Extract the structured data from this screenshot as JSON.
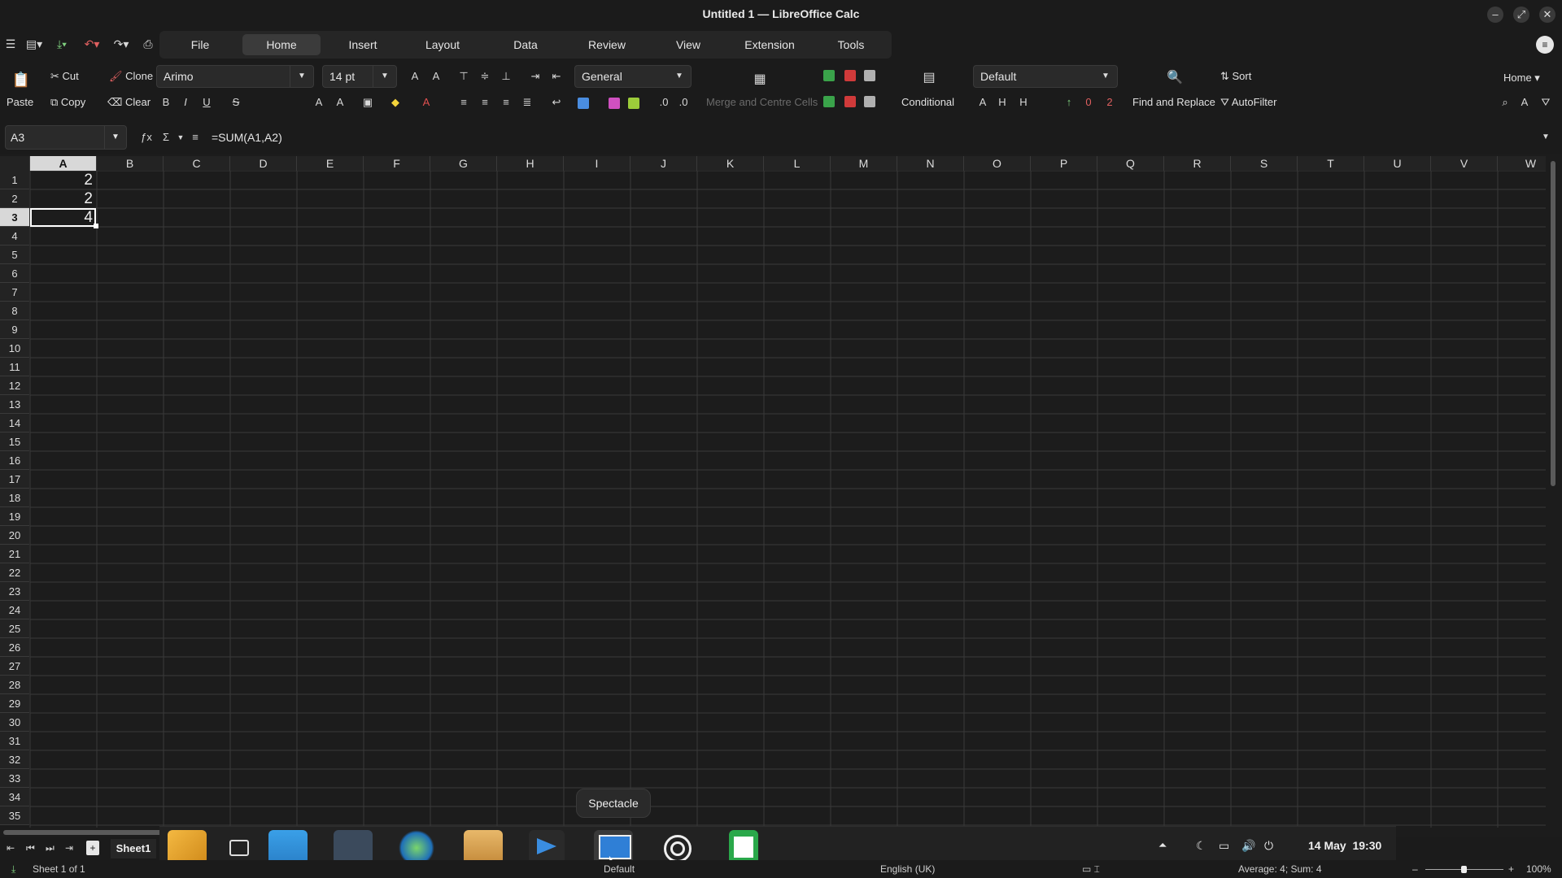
{
  "window": {
    "title": "Untitled 1 — LibreOffice Calc",
    "controls": {
      "minimize": "–",
      "restore": "⤢",
      "close": "✕"
    }
  },
  "menu_tabs": [
    "File",
    "Home",
    "Insert",
    "Layout",
    "Data",
    "Review",
    "View",
    "Extension",
    "Tools"
  ],
  "active_tab": "Home",
  "ribbon": {
    "paste": "Paste",
    "cut": "Cut",
    "copy": "Copy",
    "clone": "Clone",
    "clear": "Clear",
    "font_name": "Arimo",
    "font_size": "14 pt",
    "number_format": "General",
    "merge_label": "Merge and Centre Cells",
    "conditional": "Conditional",
    "cell_style": "Default",
    "find_replace": "Find and Replace",
    "sort": "Sort",
    "autofilter": "AutoFilter",
    "home_menu": "Home"
  },
  "formula_bar": {
    "name_box": "A3",
    "formula": "=SUM(A1,A2)"
  },
  "columns": [
    "A",
    "B",
    "C",
    "D",
    "E",
    "F",
    "G",
    "H",
    "I",
    "J",
    "K",
    "L",
    "M",
    "N",
    "O",
    "P",
    "Q",
    "R",
    "S",
    "T",
    "U",
    "V",
    "W"
  ],
  "rows": [
    "1",
    "2",
    "3",
    "4",
    "5",
    "6",
    "7",
    "8",
    "9",
    "10",
    "11",
    "12",
    "13",
    "14",
    "15",
    "16",
    "17",
    "18",
    "19",
    "20",
    "21",
    "22",
    "23",
    "24",
    "25",
    "26",
    "27",
    "28",
    "29",
    "30",
    "31",
    "32",
    "33",
    "34",
    "35"
  ],
  "selected_cell": "A3",
  "cells": {
    "A1": "2",
    "A2": "2",
    "A3": "4"
  },
  "sheet_tab": "Sheet1",
  "tooltip": "Spectacle",
  "clock": "14 May  19:30",
  "status": {
    "sheet": "Sheet 1 of 1",
    "style": "Default",
    "language": "English (UK)",
    "summary": "Average: 4; Sum: 4",
    "zoom": "100%"
  },
  "colors": {
    "accent": "#8fb8ff",
    "grid_line": "#3a3a3a",
    "background": "#1c1c1c"
  }
}
